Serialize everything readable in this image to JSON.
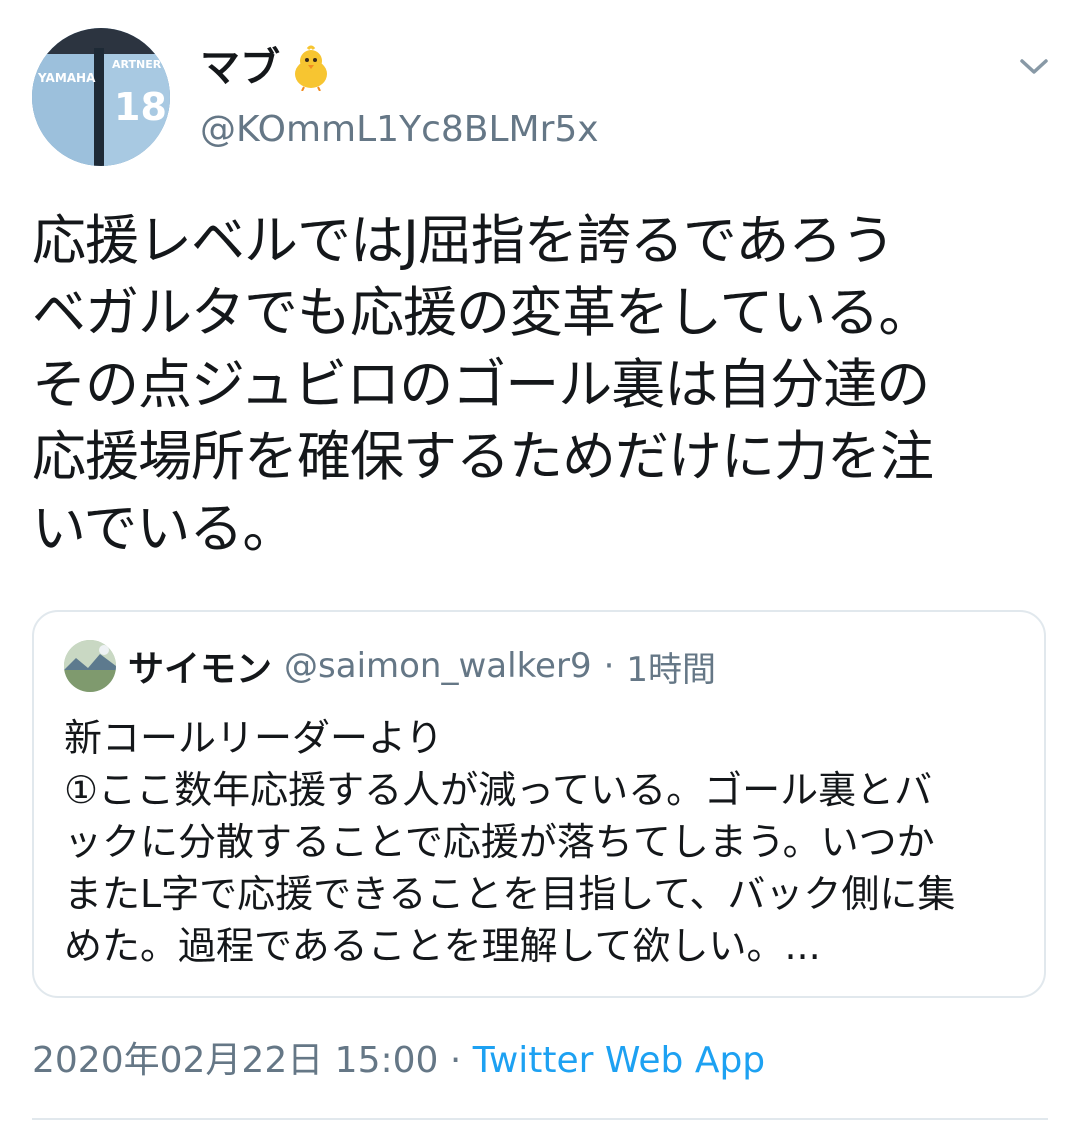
{
  "author": {
    "display_name": "マブ",
    "name_emoji_icon": "baby-chick-icon",
    "handle": "@KOmmL1Yc8BLMr5x",
    "avatar_jersey_text_left": "YAMAHA",
    "avatar_jersey_text_right": "ARTNER",
    "avatar_jersey_number": "18"
  },
  "tweet": {
    "text": "応援レベルではJ屈指を誇るであろう\nベガルタでも応援の変革をしている。\nその点ジュビロのゴール裏は自分達の\n応援場所を確保するためだけに力を注\nいでいる。"
  },
  "quoted_tweet": {
    "name": "サイモン",
    "handle": "@saimon_walker9",
    "separator": "·",
    "time": "1時間",
    "text": "新コールリーダーより\n①ここ数年応援する人が減っている。ゴール裏とバ\nックに分散することで応援が落ちてしまう。いつか\nまたL字で応援できることを目指して、バック側に集\nめた。過程であることを理解して欲しい。..."
  },
  "meta": {
    "timestamp": "2020年02月22日 15:00",
    "separator": "·",
    "source": "Twitter Web App"
  },
  "colors": {
    "text_primary": "#14171a",
    "text_secondary": "#657786",
    "link": "#1da1f2",
    "border": "#e1e8ed"
  },
  "icons": {
    "more": "chevron-down-icon"
  }
}
